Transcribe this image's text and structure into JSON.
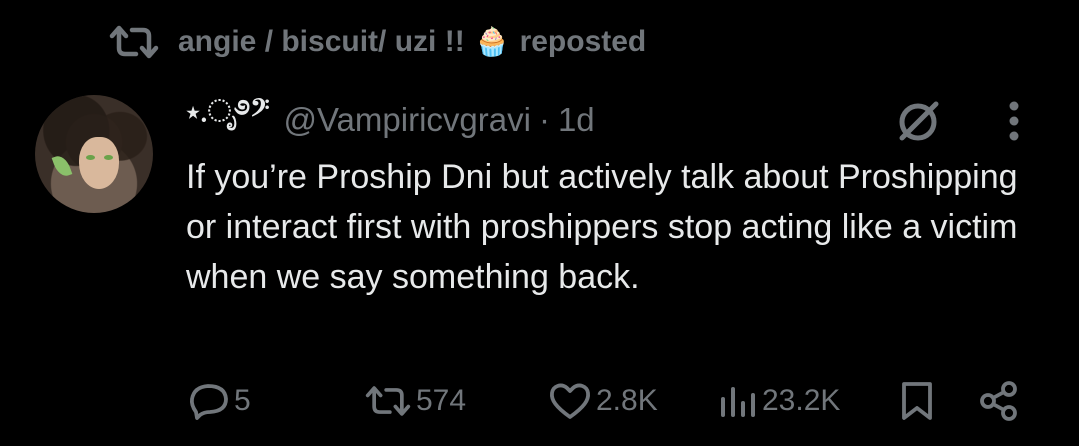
{
  "repost": {
    "icon": "repost-icon",
    "user": "angie / biscuit/ uzi !!",
    "emoji": "🧁",
    "label": "reposted"
  },
  "author": {
    "display_name": "⋆.ೃ࿔𝄢",
    "handle": "@Vampiricvgravi",
    "separator": "·",
    "time": "1d",
    "avatar": "avatar"
  },
  "post": {
    "text": "If you’re Proship Dni but actively talk about Proshipping or interact first with proshippers stop acting like a victim when we say something back."
  },
  "actions": {
    "replies": "5",
    "reposts": "574",
    "likes": "2.8K",
    "views": "23.2K"
  },
  "colors": {
    "background": "#000000",
    "text": "#e7e9ea",
    "muted": "#71767b"
  }
}
